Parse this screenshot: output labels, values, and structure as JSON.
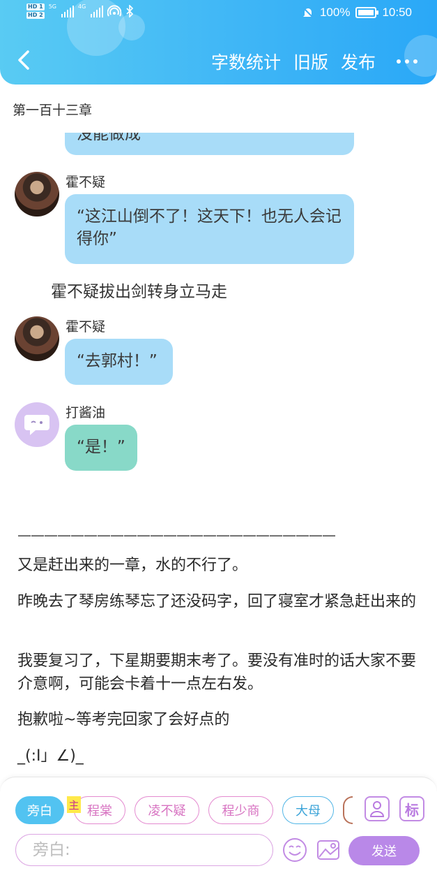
{
  "status_bar": {
    "hd1": "HD 1",
    "hd2": "HD 2",
    "net1": "5G",
    "net2": "4G",
    "battery_percent": "100%",
    "time": "10:50"
  },
  "header": {
    "word_count_label": "字数统计",
    "old_version_label": "旧版",
    "publish_label": "发布"
  },
  "chapter_title": "第一百十三章",
  "chat": {
    "cut_bubble_text": "没能做成",
    "messages": [
      {
        "speaker": "霍不疑",
        "text": "“这江山倒不了！这天下！也无人会记得你”"
      },
      {
        "narration": "霍不疑拔出剑转身立马走"
      },
      {
        "speaker": "霍不疑",
        "text": "“去郭村！”"
      },
      {
        "speaker": "打酱油",
        "text": "“是！”"
      }
    ],
    "divider": "————————————————————————",
    "notes": [
      "又是赶出来的一章，水的不行了。",
      "昨晚去了琴房练琴忘了还没码字，回了寝室才紧急赶出来的",
      "我要复习了，下星期要期末考了。要没有准时的话大家不要介意啊，可能会卡着十一点左右发。",
      "抱歉啦~等考完回家了会好点的",
      "_(:I」∠)_"
    ]
  },
  "bottom": {
    "chips": [
      "旁白",
      "程棠",
      "凌不疑",
      "程少商",
      "大母"
    ],
    "main_tag": "主",
    "mark_label": "标",
    "input_placeholder": "旁白:",
    "send_label": "发送"
  },
  "colors": {
    "header_gradient_start": "#59cbf3",
    "header_gradient_end": "#2aa8f7",
    "blue_bubble": "#a8dcf8",
    "green_bubble": "#88d9c8",
    "send_button": "#b988e8"
  }
}
